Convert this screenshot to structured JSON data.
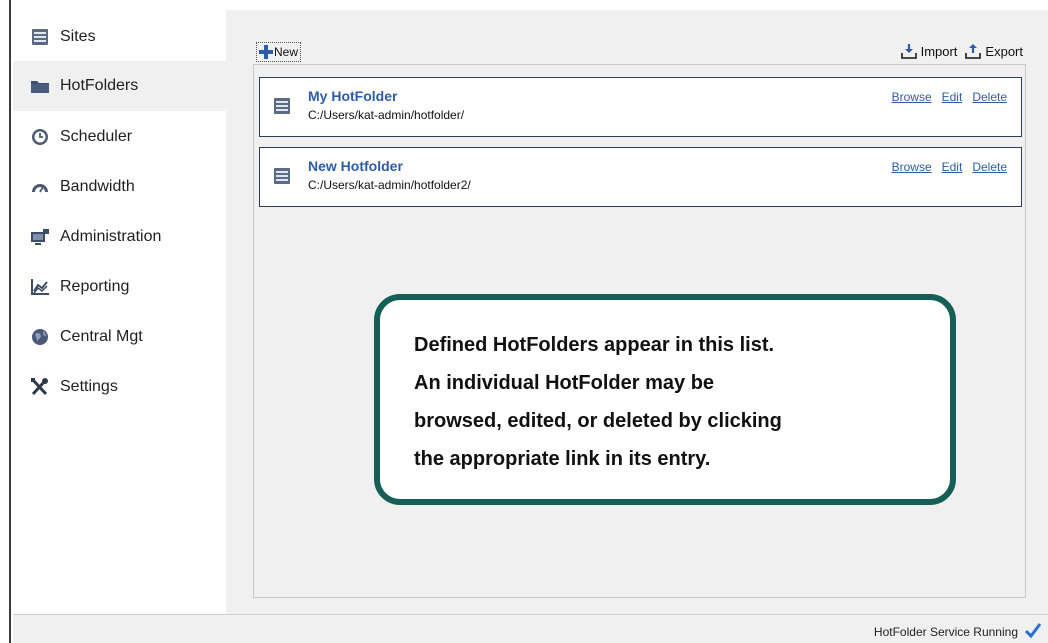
{
  "sidebar": {
    "items": [
      {
        "label": "Sites",
        "icon": "sites-icon"
      },
      {
        "label": "HotFolders",
        "icon": "folder-icon",
        "active": true
      },
      {
        "label": "Scheduler",
        "icon": "clock-icon"
      },
      {
        "label": "Bandwidth",
        "icon": "gauge-icon"
      },
      {
        "label": "Administration",
        "icon": "monitor-icon"
      },
      {
        "label": "Reporting",
        "icon": "chart-icon"
      },
      {
        "label": "Central Mgt",
        "icon": "globe-icon"
      },
      {
        "label": "Settings",
        "icon": "tools-icon"
      }
    ]
  },
  "toolbar": {
    "new_label": "New",
    "import_label": "Import",
    "export_label": "Export"
  },
  "hotfolders": [
    {
      "name": "My HotFolder",
      "path": "C:/Users/kat-admin/hotfolder/",
      "browse": "Browse",
      "edit": "Edit",
      "delete": "Delete"
    },
    {
      "name": "New Hotfolder",
      "path": "C:/Users/kat-admin/hotfolder2/",
      "browse": "Browse",
      "edit": "Edit",
      "delete": "Delete"
    }
  ],
  "callout": {
    "lines": [
      "Defined HotFolders appear in this list.",
      "An individual HotFolder may be",
      "browsed, edited, or deleted by clicking",
      "the appropriate link in its entry."
    ]
  },
  "status": {
    "text": "HotFolder Service Running"
  },
  "colors": {
    "link": "#2d5da6",
    "callout_border": "#155f56",
    "row_border": "#2f3d5a",
    "check": "#2a6fd1"
  }
}
